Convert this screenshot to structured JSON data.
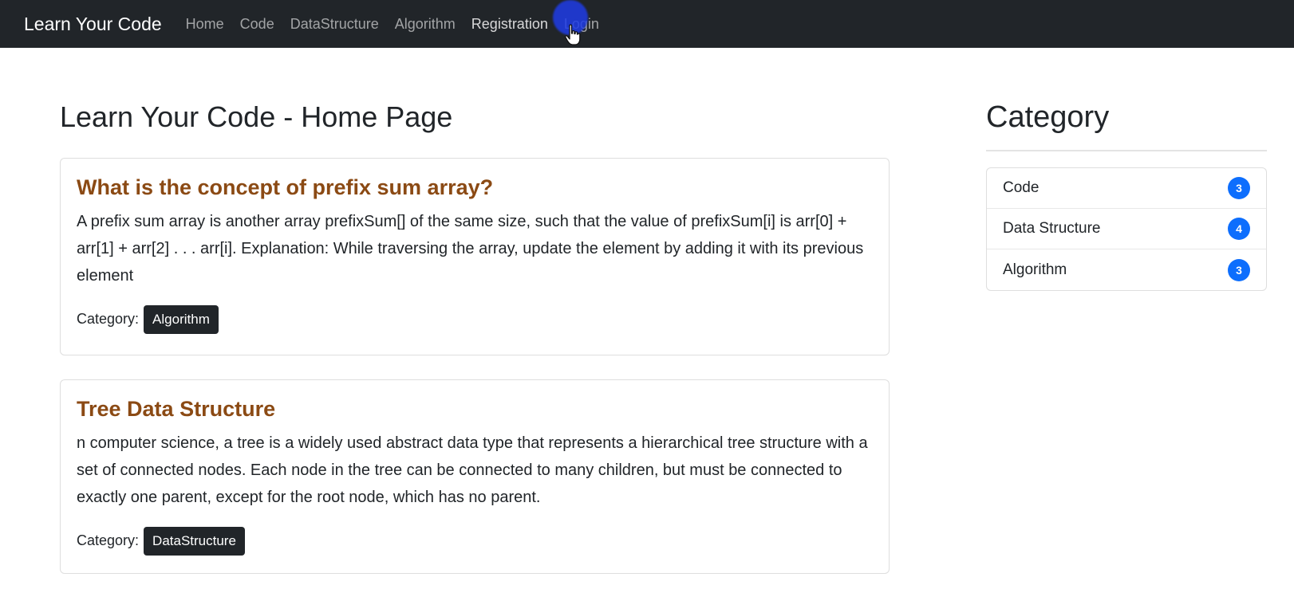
{
  "navbar": {
    "brand": "Learn Your Code",
    "links": [
      "Home",
      "Code",
      "DataStructure",
      "Algorithm",
      "Registration",
      "Login"
    ]
  },
  "main": {
    "title": "Learn Your Code - Home Page",
    "posts": [
      {
        "title": "What is the concept of prefix sum array?",
        "body": "A prefix sum array is another array prefixSum[] of the same size, such that the value of prefixSum[i] is arr[0] + arr[1] + arr[2] . . . arr[i]. Explanation: While traversing the array, update the element by adding it with its previous element",
        "category_label": "Category:",
        "category": "Algorithm"
      },
      {
        "title": "Tree Data Structure",
        "body": "n computer science, a tree is a widely used abstract data type that represents a hierarchical tree structure with a set of connected nodes. Each node in the tree can be connected to many children, but must be connected to exactly one parent, except for the root node, which has no parent.",
        "category_label": "Category:",
        "category": "DataStructure"
      }
    ]
  },
  "sidebar": {
    "title": "Category",
    "items": [
      {
        "label": "Code",
        "count": "3"
      },
      {
        "label": "Data Structure",
        "count": "4"
      },
      {
        "label": "Algorithm",
        "count": "3"
      }
    ]
  },
  "colors": {
    "navbar_bg": "#212529",
    "post_title": "#8b4a14",
    "badge_primary": "#0d6efd",
    "badge_dark": "#212529"
  },
  "icons": [
    "hand-pointer-cursor-icon"
  ]
}
